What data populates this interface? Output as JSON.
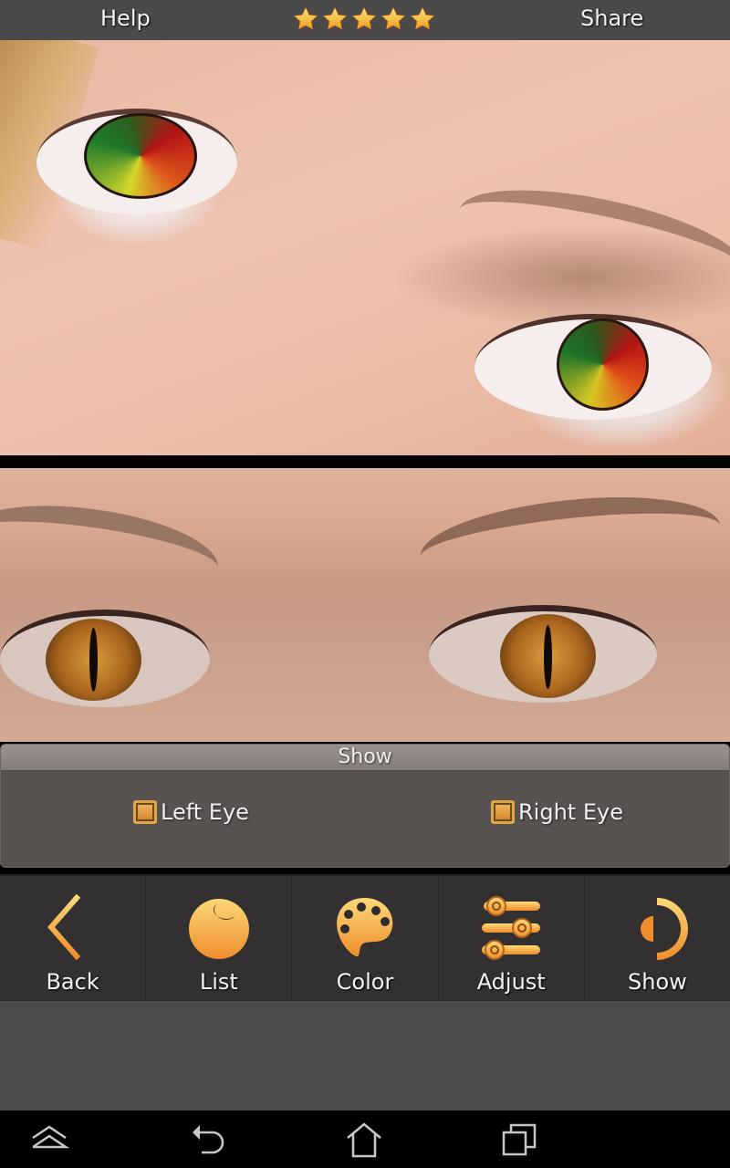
{
  "topbar": {
    "help_label": "Help",
    "share_label": "Share",
    "rating_stars": 5,
    "rating_icon": "star-icon",
    "star_color": "#f7b733"
  },
  "photos": {
    "top": {
      "description": "Close-up of eyes with red-yellow-green iris effect"
    },
    "bottom": {
      "description": "Close-up of eyes with amber cat-eye iris effect"
    }
  },
  "show_panel": {
    "title": "Show",
    "options": [
      {
        "label": "Left Eye",
        "checked": true
      },
      {
        "label": "Right Eye",
        "checked": true
      }
    ]
  },
  "toolbar": {
    "accent_color": "#f5a742",
    "items": [
      {
        "label": "Back",
        "icon": "chevron-left-icon"
      },
      {
        "label": "List",
        "icon": "eye-ball-icon"
      },
      {
        "label": "Color",
        "icon": "palette-icon"
      },
      {
        "label": "Adjust",
        "icon": "sliders-icon"
      },
      {
        "label": "Show",
        "icon": "half-circle-icon"
      }
    ]
  },
  "system_nav": {
    "items": [
      "collapse-icon",
      "back-icon",
      "home-icon",
      "recent-apps-icon"
    ]
  }
}
